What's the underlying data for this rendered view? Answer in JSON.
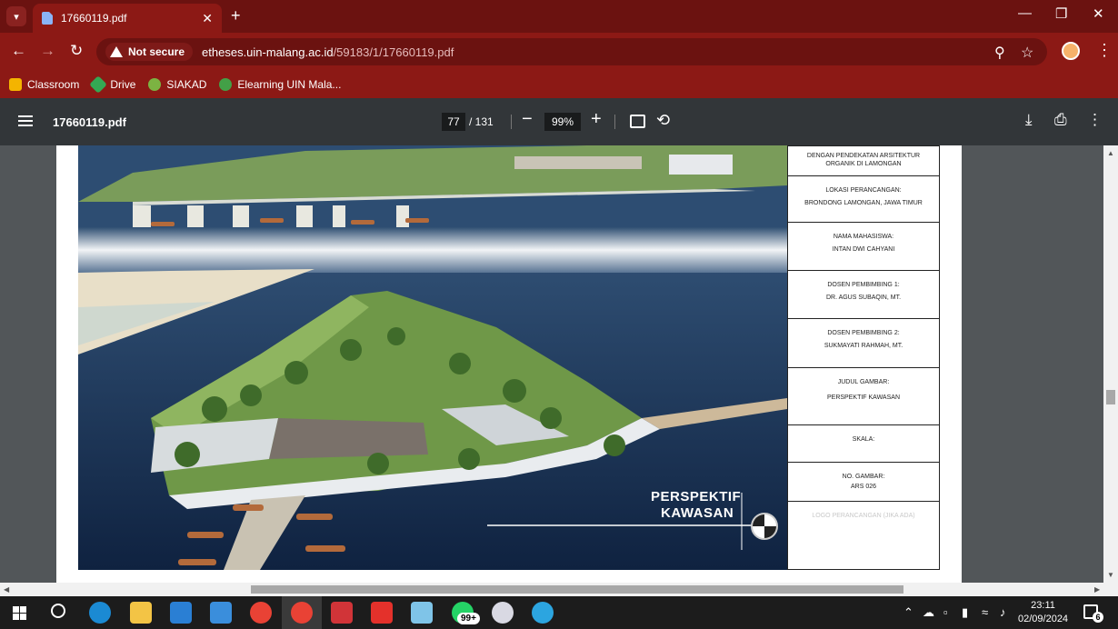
{
  "browser": {
    "tab_title": "17660119.pdf",
    "new_tab": "+",
    "security_label": "Not secure",
    "url_host": "etheses.uin-malang.ac.id",
    "url_path": "/59183/1/17660119.pdf",
    "bookmarks": [
      {
        "label": "Classroom",
        "color": "#f4b400"
      },
      {
        "label": "Drive",
        "color": "#34a853"
      },
      {
        "label": "SIAKAD",
        "color": "#7cb342"
      },
      {
        "label": "Elearning UIN Mala...",
        "color": "#43a047"
      }
    ],
    "theme_color": "#8c1915"
  },
  "pdf": {
    "title": "17660119.pdf",
    "page_current": "77",
    "page_total": "/ 131",
    "zoom": "99%"
  },
  "drawing": {
    "project_title": "DENGAN PENDEKATAN ARSITEKTUR ORGANIK DI LAMONGAN",
    "cells": [
      {
        "label": "LOKASI PERANCANGAN:",
        "value": "BRONDONG LAMONGAN, JAWA TIMUR"
      },
      {
        "label": "NAMA MAHASISWA:",
        "value": "INTAN DWI CAHYANI"
      },
      {
        "label": "DOSEN PEMBIMBING 1:",
        "value": "DR. AGUS SUBAQIN, MT."
      },
      {
        "label": "DOSEN PEMBIMBING 2:",
        "value": "SUKMAYATI RAHMAH, MT."
      },
      {
        "label": "JUDUL GAMBAR:",
        "value": "PERSPEKTIF KAWASAN"
      },
      {
        "label": "SKALA:",
        "value": ""
      },
      {
        "label": "NO. GAMBAR:",
        "value": "ARS 026"
      }
    ],
    "logo_placeholder": "LOGO PERANCANGAN (JIKA ADA)",
    "render_label_1": "PERSPEKTIF",
    "render_label_2": "KAWASAN"
  },
  "taskbar": {
    "badge_count": "99+",
    "time": "23:11",
    "date": "02/09/2024",
    "notification_count": "6"
  }
}
